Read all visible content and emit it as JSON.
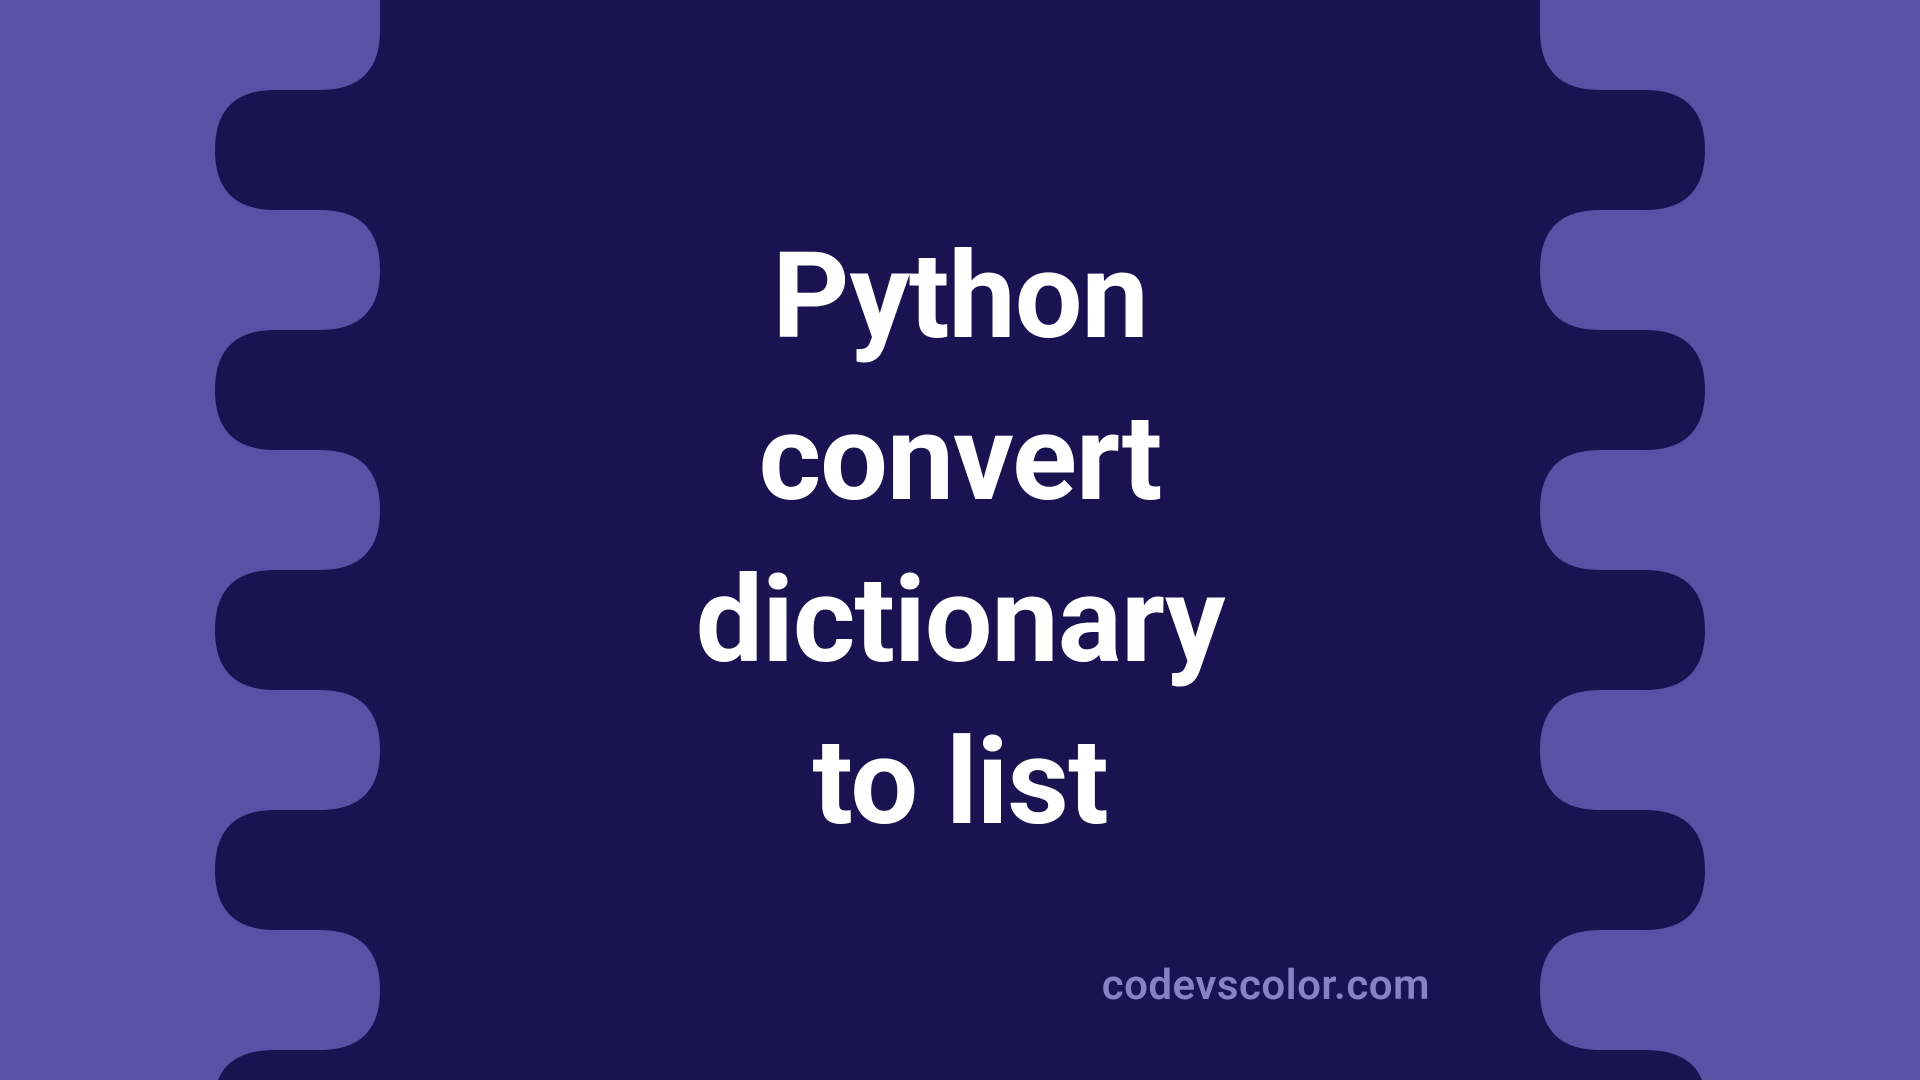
{
  "colors": {
    "background": "#5a50a5",
    "blob": "#1b1351",
    "title": "#ffffff",
    "credit": "#8a81c4"
  },
  "title_lines": [
    "Python",
    "convert",
    "dictionary",
    "to list"
  ],
  "credit": "codevscolor.com"
}
